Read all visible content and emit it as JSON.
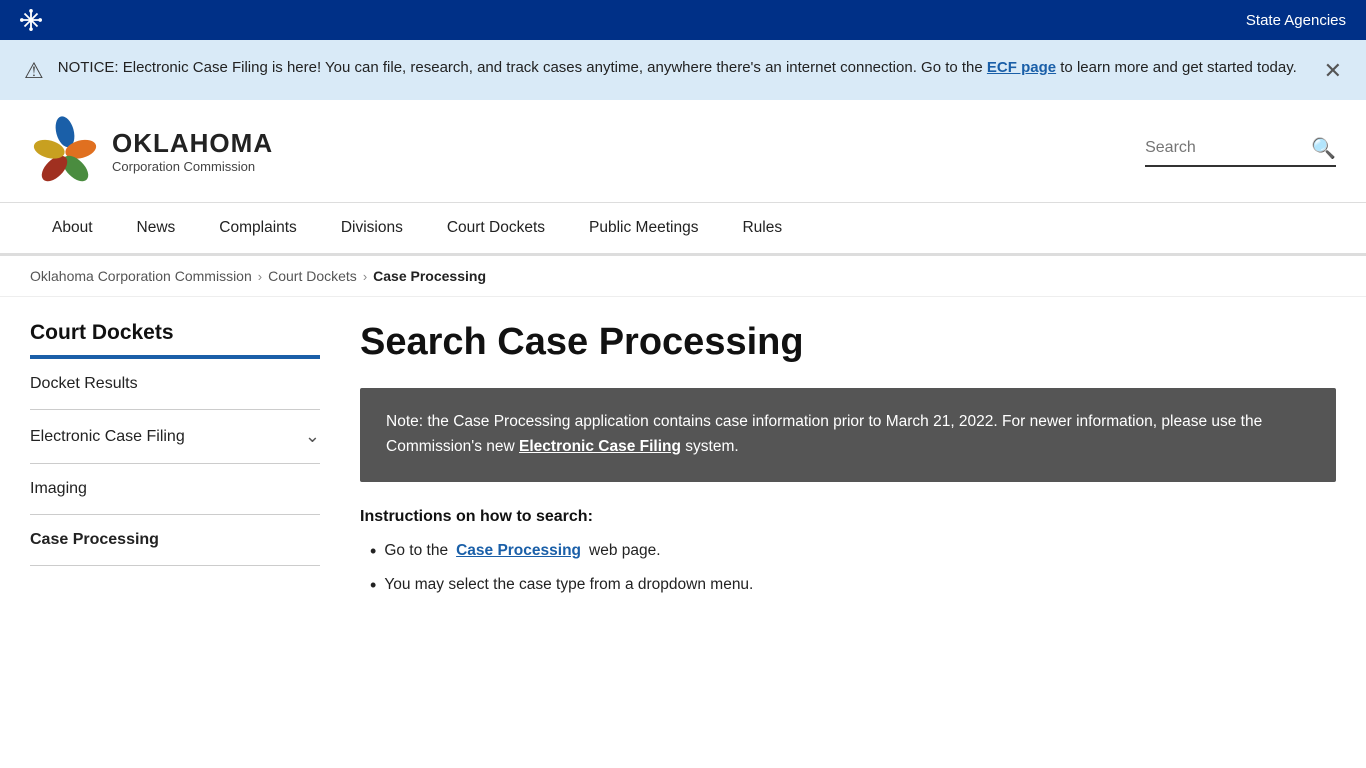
{
  "topbar": {
    "state_agencies_label": "State Agencies"
  },
  "notice": {
    "text_before_link": "NOTICE: Electronic Case Filing is here! You can file, research, and track cases anytime, anywhere there's an internet connection. Go to the ",
    "link_text": "ECF page",
    "text_after_link": " to learn more and get started today."
  },
  "header": {
    "logo_oklahoma": "OKLAHOMA",
    "logo_sub": "Corporation Commission",
    "search_placeholder": "Search"
  },
  "nav": {
    "items": [
      {
        "label": "About"
      },
      {
        "label": "News"
      },
      {
        "label": "Complaints"
      },
      {
        "label": "Divisions"
      },
      {
        "label": "Court Dockets"
      },
      {
        "label": "Public Meetings"
      },
      {
        "label": "Rules"
      }
    ]
  },
  "breadcrumb": {
    "items": [
      {
        "label": "Oklahoma Corporation Commission",
        "link": true
      },
      {
        "label": "Court Dockets",
        "link": true
      },
      {
        "label": "Case Processing",
        "link": false
      }
    ]
  },
  "sidebar": {
    "title": "Court Dockets",
    "items": [
      {
        "label": "Docket Results",
        "active": false,
        "expandable": false
      },
      {
        "label": "Electronic Case Filing",
        "active": false,
        "expandable": true
      },
      {
        "label": "Imaging",
        "active": false,
        "expandable": false
      },
      {
        "label": "Case Processing",
        "active": true,
        "expandable": false
      }
    ]
  },
  "main": {
    "page_title": "Search Case Processing",
    "info_box": {
      "text_before": "Note: the Case Processing application contains case information prior to March 21, 2022. For newer information, please use the Commission's new ",
      "link_text": "Electronic Case Filing",
      "text_after": " system."
    },
    "instructions_title": "Instructions on how to search:",
    "instruction_items": [
      {
        "text_before": "Go to the ",
        "link_text": "Case Processing",
        "text_after": " web page."
      },
      {
        "text_before": "You may select the case type from a dropdown menu.",
        "link_text": "",
        "text_after": ""
      }
    ]
  }
}
